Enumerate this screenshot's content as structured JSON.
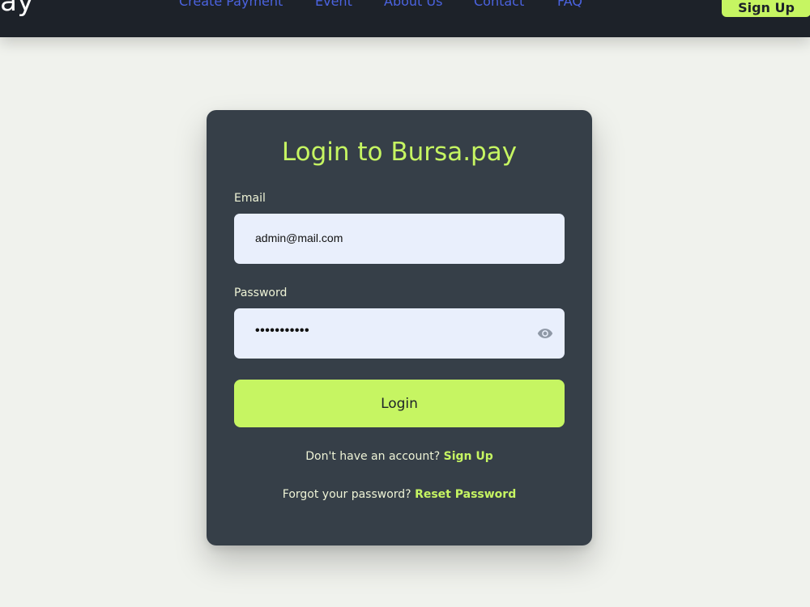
{
  "header": {
    "logo": "pay",
    "nav": [
      "Create Payment",
      "Event",
      "About Us",
      "Contact",
      "FAQ"
    ],
    "signup_label": "Sign Up"
  },
  "colors": {
    "accent": "#c6f562",
    "header_bg": "#1d2229",
    "card_bg": "#363f48",
    "nav_link": "#4b63e0",
    "input_bg": "#e9effc",
    "page_bg": "#f0f2ed"
  },
  "login": {
    "title": "Login to Bursa.pay",
    "email_label": "Email",
    "email_value": "admin@mail.com",
    "password_label": "Password",
    "password_value": "•••••••••••",
    "password_toggle_icon": "eye-icon",
    "login_button": "Login",
    "signup_prompt": "Don't have an account?",
    "signup_link": "Sign Up",
    "forgot_prompt": "Forgot your password?",
    "reset_link": "Reset Password"
  }
}
